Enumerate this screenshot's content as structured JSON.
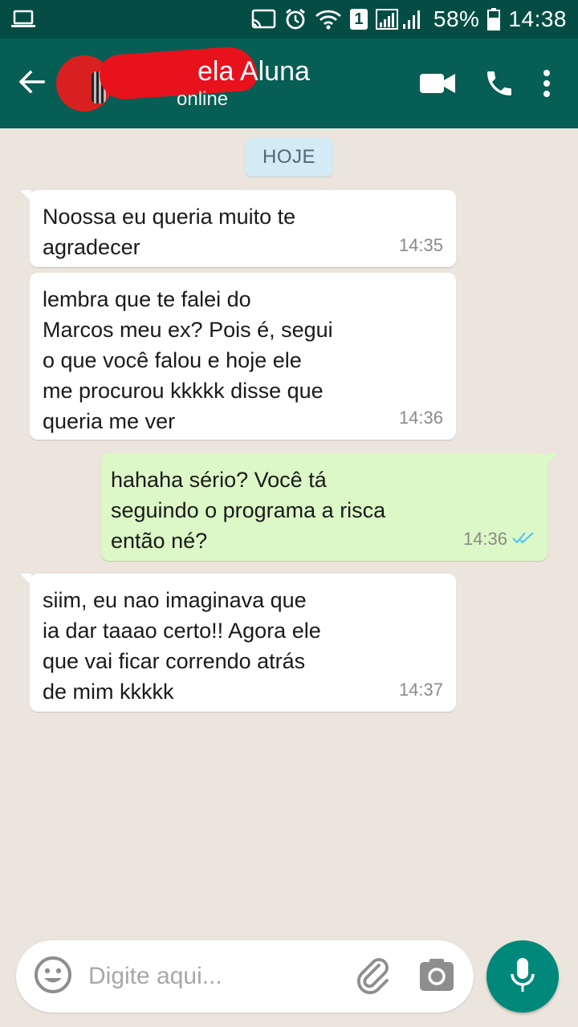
{
  "status_bar": {
    "battery": "58%",
    "time": "14:38",
    "sim_badge": "1",
    "icons": [
      "laptop-icon",
      "cast-icon",
      "alarm-icon",
      "wifi-icon",
      "signal-icon",
      "battery-icon"
    ]
  },
  "header": {
    "contact_name": "ela Aluna",
    "status": "online",
    "icons": [
      "back-arrow-icon",
      "video-call-icon",
      "phone-icon",
      "more-vert-icon"
    ]
  },
  "chat": {
    "date_chip": "HOJE",
    "messages": [
      {
        "direction": "in",
        "text": "Noossa eu queria muito te\nagradecer",
        "time": "14:35"
      },
      {
        "direction": "in",
        "text": "lembra que te falei do\nMarcos meu ex? Pois é, segui\no que você falou e hoje ele\nme procurou kkkkk disse que\nqueria me ver",
        "time": "14:36"
      },
      {
        "direction": "out",
        "text": "hahaha sério? Você tá\nseguindo o programa a risca\nentão né?",
        "time": "14:36",
        "read": true
      },
      {
        "direction": "in",
        "text": "siim, eu nao imaginava que\nia dar taaao certo!! Agora ele\nque vai ficar correndo atrás\nde mim kkkkk",
        "time": "14:37"
      }
    ]
  },
  "input_bar": {
    "placeholder": "Digite aqui...",
    "icons": [
      "emoji-icon",
      "attach-icon",
      "camera-icon",
      "mic-icon"
    ]
  },
  "colors": {
    "header": "#075e54",
    "status_bar": "#054d44",
    "chat_bg": "#ece5dd",
    "bubble_in": "#ffffff",
    "bubble_out": "#dcf8c6",
    "read_ticks": "#4fc3f7",
    "mic_button": "#00897b"
  }
}
